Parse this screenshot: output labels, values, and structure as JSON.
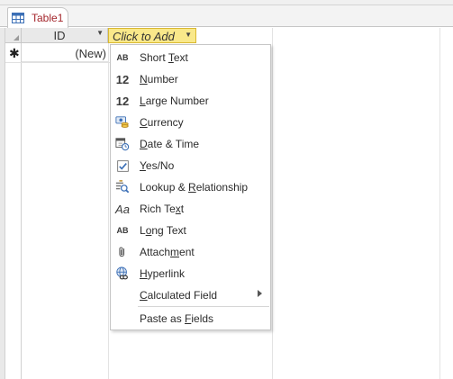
{
  "tab": {
    "title": "Table1"
  },
  "grid": {
    "id_header": "ID",
    "add_header": "Click to Add",
    "new_record_value": "(New)",
    "new_record_marker": "✱"
  },
  "menu": {
    "items": [
      {
        "pre": "Short ",
        "key": "T",
        "post": "ext",
        "icon": "ab-text-icon",
        "glyph": "AB"
      },
      {
        "pre": "",
        "key": "N",
        "post": "umber",
        "icon": "number-icon",
        "glyph": "12"
      },
      {
        "pre": "",
        "key": "L",
        "post": "arge Number",
        "icon": "large-number-icon",
        "glyph": "12"
      },
      {
        "pre": "",
        "key": "C",
        "post": "urrency",
        "icon": "currency-icon",
        "glyph": ""
      },
      {
        "pre": "",
        "key": "D",
        "post": "ate & Time",
        "icon": "calendar-clock-icon",
        "glyph": ""
      },
      {
        "pre": "",
        "key": "Y",
        "post": "es/No",
        "icon": "checkbox-icon",
        "glyph": ""
      },
      {
        "pre": "Lookup & ",
        "key": "R",
        "post": "elationship",
        "icon": "lookup-icon",
        "glyph": ""
      },
      {
        "pre": "Rich Te",
        "key": "x",
        "post": "t",
        "icon": "rich-text-icon",
        "glyph": "Aa"
      },
      {
        "pre": "L",
        "key": "o",
        "post": "ng Text",
        "icon": "long-text-icon",
        "glyph": "AB"
      },
      {
        "pre": "Attach",
        "key": "m",
        "post": "ent",
        "icon": "paperclip-icon",
        "glyph": ""
      },
      {
        "pre": "",
        "key": "H",
        "post": "yperlink",
        "icon": "hyperlink-icon",
        "glyph": ""
      },
      {
        "pre": "",
        "key": "C",
        "post": "alculated Field",
        "icon": "",
        "glyph": "",
        "submenu": true
      },
      {
        "pre": "Paste as ",
        "key": "F",
        "post": "ields",
        "icon": "",
        "glyph": ""
      }
    ]
  }
}
